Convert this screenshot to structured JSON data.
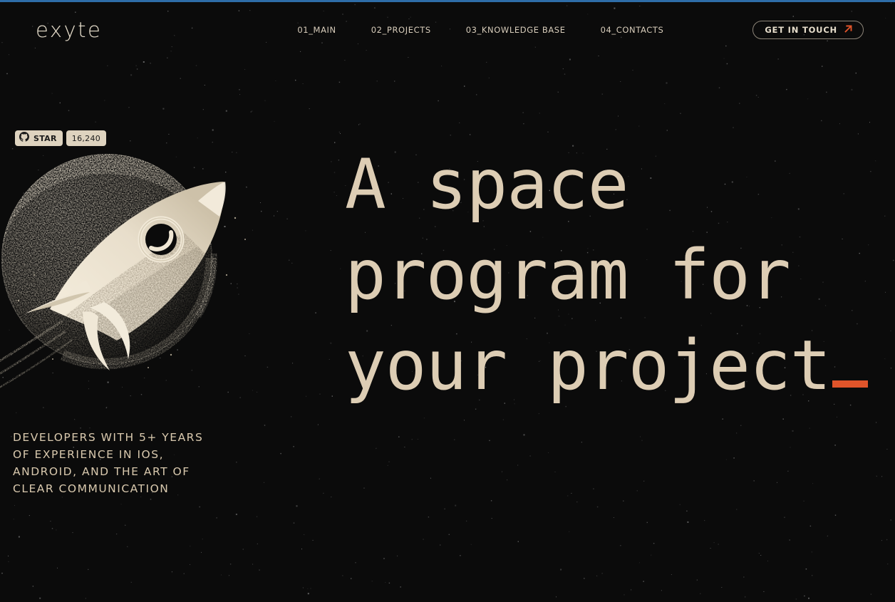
{
  "meta": {
    "background_color": "#0b0b0b",
    "accent_color": "#e0542a",
    "text_color": "#ddcdb4",
    "progress_color": "#2e6da8"
  },
  "header": {
    "logo": "exyte",
    "nav": [
      {
        "label": "01_MAIN"
      },
      {
        "label": "02_PROJECTS"
      },
      {
        "label": "03_KNOWLEDGE BASE"
      },
      {
        "label": "04_CONTACTS"
      }
    ],
    "cta": {
      "label": "GET IN TOUCH",
      "icon": "arrow-up-right-icon",
      "icon_color": "#e0542a"
    }
  },
  "github_badge": {
    "icon": "github-icon",
    "star_label": "STAR",
    "count": "16,240"
  },
  "hero": {
    "heading_lines": [
      "A space",
      "program for",
      "your project"
    ],
    "caret": "_",
    "sub_lines": [
      "DEVELOPERS WITH 5+ YEARS",
      "OF EXPERIENCE IN IOS,",
      "ANDROID, AND THE ART OF",
      "CLEAR COMMUNICATION"
    ]
  },
  "illustration": {
    "name": "rocket-and-planet-illustration",
    "description": "stippled rocket flying past a planet"
  }
}
